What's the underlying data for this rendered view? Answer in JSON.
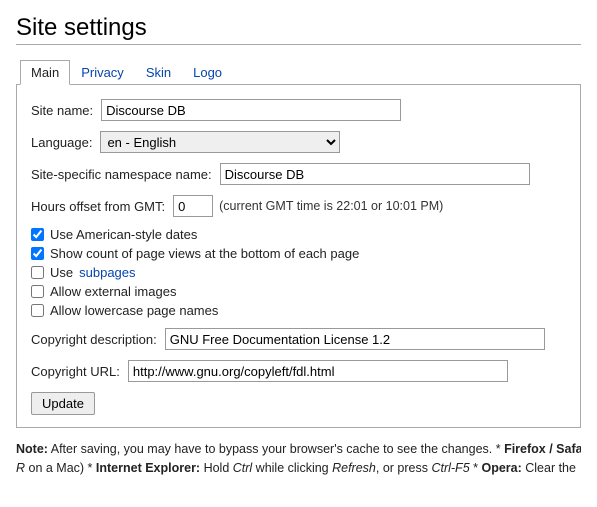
{
  "page_title": "Site settings",
  "tabs": {
    "main": "Main",
    "privacy": "Privacy",
    "skin": "Skin",
    "logo": "Logo"
  },
  "form": {
    "site_name_label": "Site name:",
    "site_name_value": "Discourse DB",
    "language_label": "Language:",
    "language_value": "en - English",
    "namespace_label": "Site-specific namespace name:",
    "namespace_value": "Discourse DB",
    "hours_label": "Hours offset from GMT:",
    "hours_value": "0",
    "gmt_hint": "(current GMT time is 22:01 or 10:01 PM)",
    "chk_american": "Use American-style dates",
    "chk_views": "Show count of page views at the bottom of each page",
    "chk_subpages_prefix": "Use ",
    "chk_subpages_link": "subpages",
    "chk_external": "Allow external images",
    "chk_lowercase": "Allow lowercase page names",
    "copyright_desc_label": "Copyright description:",
    "copyright_desc_value": "GNU Free Documentation License 1.2",
    "copyright_url_label": "Copyright URL:",
    "copyright_url_value": "http://www.gnu.org/copyleft/fdl.html",
    "update_button": "Update"
  },
  "note": {
    "prefix": "Note:",
    "body1": " After saving, you may have to bypass your browser's cache to see the changes. * ",
    "firefox": "Firefox / Safari:",
    "body2": " ",
    "rmac": "R",
    "body3": " on a Mac) * ",
    "ie": "Internet Explorer:",
    "body4": " Hold ",
    "ctrl": "Ctrl",
    "body5": " while clicking ",
    "refresh": "Refresh",
    "body6": ", or press ",
    "ctrlf5": "Ctrl-F5",
    "body7": " * ",
    "opera": "Opera:",
    "body8": " Clear the"
  }
}
